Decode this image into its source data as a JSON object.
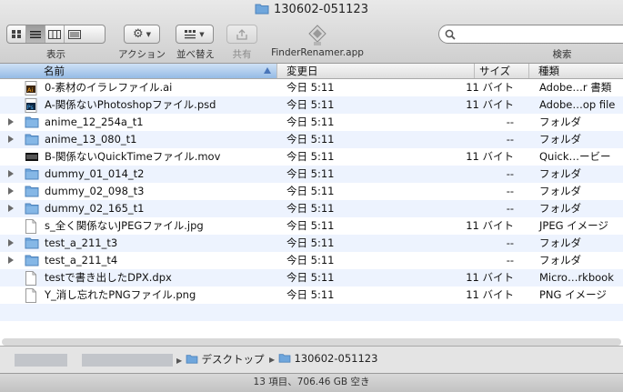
{
  "window": {
    "title": "130602-051123"
  },
  "toolbar": {
    "view_label": "表示",
    "action_label": "アクション",
    "arrange_label": "並べ替え",
    "share_label": "共有",
    "app_label": "FinderRenamer.app",
    "search_label": "検索",
    "search_value": ""
  },
  "columns": {
    "name": "名前",
    "date": "変更日",
    "size": "サイズ",
    "kind": "種類"
  },
  "files": [
    {
      "name": "0-素材のイラレファイル.ai",
      "date": "今日 5:11",
      "size": "11 バイト",
      "kind": "Adobe…r 書類",
      "type": "ai",
      "folder": false
    },
    {
      "name": "A-関係ないPhotoshopファイル.psd",
      "date": "今日 5:11",
      "size": "11 バイト",
      "kind": "Adobe…op file",
      "type": "psd",
      "folder": false
    },
    {
      "name": "anime_12_254a_t1",
      "date": "今日 5:11",
      "size": "--",
      "kind": "フォルダ",
      "type": "folder",
      "folder": true
    },
    {
      "name": "anime_13_080_t1",
      "date": "今日 5:11",
      "size": "--",
      "kind": "フォルダ",
      "type": "folder",
      "folder": true
    },
    {
      "name": "B-関係ないQuickTimeファイル.mov",
      "date": "今日 5:11",
      "size": "11 バイト",
      "kind": "Quick…ービー",
      "type": "mov",
      "folder": false
    },
    {
      "name": "dummy_01_014_t2",
      "date": "今日 5:11",
      "size": "--",
      "kind": "フォルダ",
      "type": "folder",
      "folder": true
    },
    {
      "name": "dummy_02_098_t3",
      "date": "今日 5:11",
      "size": "--",
      "kind": "フォルダ",
      "type": "folder",
      "folder": true
    },
    {
      "name": "dummy_02_165_t1",
      "date": "今日 5:11",
      "size": "--",
      "kind": "フォルダ",
      "type": "folder",
      "folder": true
    },
    {
      "name": "s_全く関係ないJPEGファイル.jpg",
      "date": "今日 5:11",
      "size": "11 バイト",
      "kind": "JPEG イメージ",
      "type": "doc",
      "folder": false
    },
    {
      "name": "test_a_211_t3",
      "date": "今日 5:11",
      "size": "--",
      "kind": "フォルダ",
      "type": "folder",
      "folder": true
    },
    {
      "name": "test_a_211_t4",
      "date": "今日 5:11",
      "size": "--",
      "kind": "フォルダ",
      "type": "folder",
      "folder": true
    },
    {
      "name": "testで書き出したDPX.dpx",
      "date": "今日 5:11",
      "size": "11 バイト",
      "kind": "Micro…rkbook",
      "type": "doc",
      "folder": false
    },
    {
      "name": "Y_消し忘れたPNGファイル.png",
      "date": "今日 5:11",
      "size": "11 バイト",
      "kind": "PNG イメージ",
      "type": "doc",
      "folder": false
    }
  ],
  "path": {
    "items": [
      "デスクトップ",
      "130602-051123"
    ]
  },
  "status": {
    "text": "13 項目、706.46 GB 空き"
  },
  "colors": {
    "folder": "#6fa6dc",
    "selected_header": "#95bbe5",
    "alt_row": "#edf3fe"
  }
}
